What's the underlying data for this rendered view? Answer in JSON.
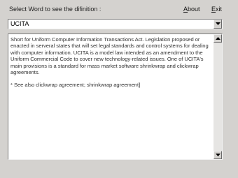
{
  "header": {
    "prompt": "Select Word to see the difinition :",
    "about_label": "About",
    "about_hotkey": "A",
    "about_rest": "bout",
    "exit_label": "Exit",
    "exit_hotkey": "E",
    "exit_rest": "xit"
  },
  "word_select": {
    "selected": "UCITA"
  },
  "definition": {
    "paragraph_1": "Short for Uniform Computer Information Transactions Act. Legislation proposed or enacted in serveral states that will set legal standards and control systems for dealing with computer information. UCITA is a model law intended as an amendment to the Uniform Commercial Code to cover new technology-related issues. One of UCITA's main provisions is a standard for mass market software shrinkwrap and clickwrap agreements.",
    "paragraph_2": "* See also clickwrap agreement; shrinkwrap agreement]"
  },
  "icons": {
    "combo_arrow": "chevron-down-icon",
    "scroll_up": "arrow-up-icon",
    "scroll_down": "arrow-down-icon"
  }
}
